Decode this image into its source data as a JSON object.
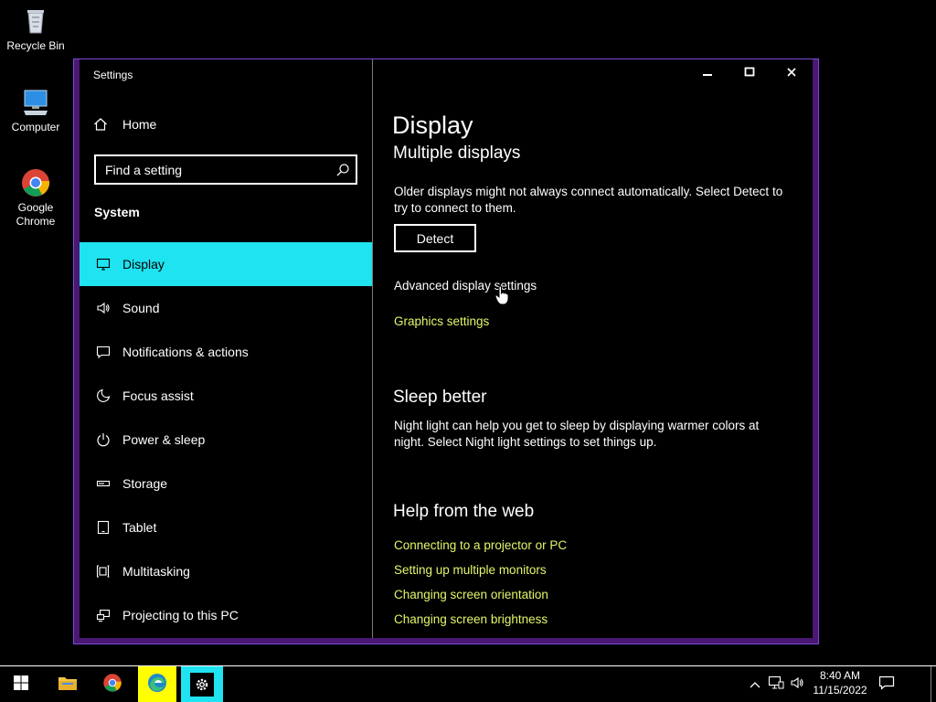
{
  "desktop": {
    "icons": [
      {
        "label": "Recycle Bin",
        "icon": "recycle-bin-icon"
      },
      {
        "label": "Computer",
        "icon": "computer-icon"
      },
      {
        "label": "Google Chrome",
        "icon": "chrome-icon"
      }
    ]
  },
  "window": {
    "title": "Settings",
    "controls": {
      "minimize": "minimize-icon",
      "maximize": "maximize-icon",
      "close": "close-icon"
    }
  },
  "sidebar": {
    "home_label": "Home",
    "search_placeholder": "Find a setting",
    "section": "System",
    "items": [
      {
        "label": "Display",
        "icon": "monitor-icon",
        "active": true
      },
      {
        "label": "Sound",
        "icon": "speaker-icon"
      },
      {
        "label": "Notifications & actions",
        "icon": "notification-icon"
      },
      {
        "label": "Focus assist",
        "icon": "moon-icon"
      },
      {
        "label": "Power & sleep",
        "icon": "power-icon"
      },
      {
        "label": "Storage",
        "icon": "storage-icon"
      },
      {
        "label": "Tablet",
        "icon": "tablet-icon"
      },
      {
        "label": "Multitasking",
        "icon": "multitasking-icon"
      },
      {
        "label": "Projecting to this PC",
        "icon": "projecting-icon"
      }
    ]
  },
  "content": {
    "page_title": "Display",
    "multiple_displays": {
      "heading": "Multiple displays",
      "description": "Older displays might not always connect automatically. Select Detect to try to connect to them.",
      "detect_label": "Detect",
      "advanced_link": "Advanced display settings",
      "graphics_link": "Graphics settings"
    },
    "sleep_better": {
      "heading": "Sleep better",
      "description": "Night light can help you get to sleep by displaying warmer colors at night. Select Night light settings to set things up."
    },
    "help": {
      "heading": "Help from the web",
      "links": [
        "Connecting to a projector or PC",
        "Setting up multiple monitors",
        "Changing screen orientation",
        "Changing screen brightness"
      ]
    }
  },
  "taskbar": {
    "apps": [
      "start-icon",
      "file-explorer-icon",
      "chrome-icon",
      "edge-icon",
      "settings-icon"
    ],
    "tray": [
      "chevron-up-icon",
      "network-icon",
      "volume-icon"
    ],
    "time": "8:40 AM",
    "date": "11/15/2022",
    "action_center": "action-center-icon"
  },
  "colors": {
    "accent_active": "#1fe3f0",
    "link": "#e6f56a",
    "window_border": "#4a1873",
    "taskbar_highlight": "#ffff00"
  }
}
